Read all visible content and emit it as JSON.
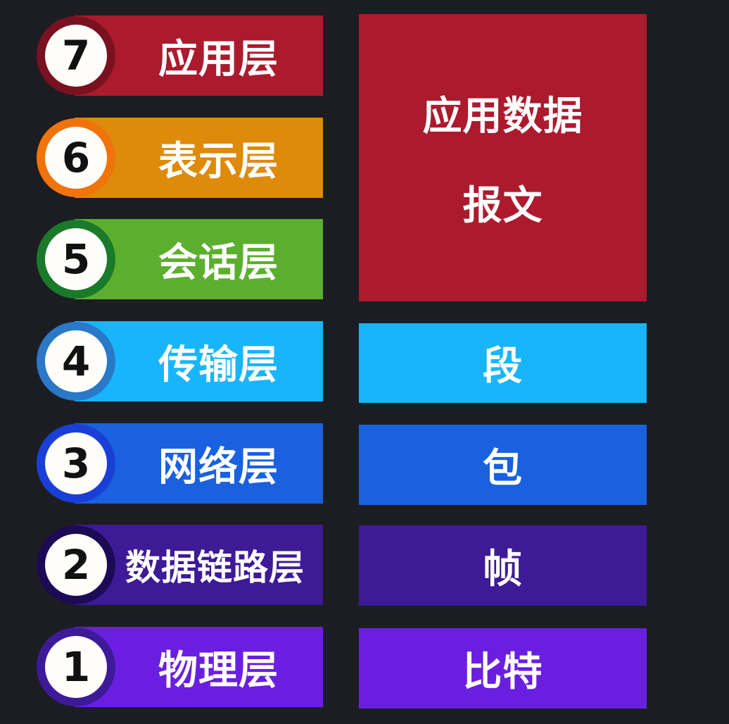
{
  "layers": [
    {
      "number": "7",
      "name": "应用层",
      "color": "#ac1a2e",
      "ring": "#7a1120"
    },
    {
      "number": "6",
      "name": "表示层",
      "color": "#de8a0b",
      "ring": "#f0730c"
    },
    {
      "number": "5",
      "name": "会话层",
      "color": "#5caf2e",
      "ring": "#1a7a2a"
    },
    {
      "number": "4",
      "name": "传输层",
      "color": "#19b5fb",
      "ring": "#2a78c8"
    },
    {
      "number": "3",
      "name": "网络层",
      "color": "#1961df",
      "ring": "#1a3fd6"
    },
    {
      "number": "2",
      "name": "数据链路层",
      "color": "#3d1a96",
      "ring": "#1c0a55"
    },
    {
      "number": "1",
      "name": "物理层",
      "color": "#6a1fe0",
      "ring": "#3d1a9a"
    }
  ],
  "pdus": [
    {
      "lines": [
        "应用数据",
        "报文"
      ],
      "color": "#ac1a2e"
    },
    {
      "lines": [
        "段"
      ],
      "color": "#19b5fb"
    },
    {
      "lines": [
        "包"
      ],
      "color": "#1961df"
    },
    {
      "lines": [
        "帧"
      ],
      "color": "#3d1a96"
    },
    {
      "lines": [
        "比特"
      ],
      "color": "#6a1fe0"
    }
  ]
}
